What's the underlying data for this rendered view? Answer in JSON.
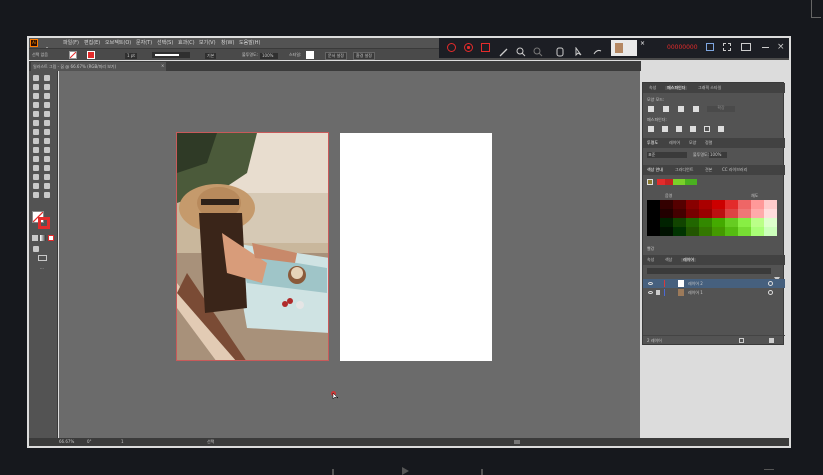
{
  "app": {
    "logo": "Ai",
    "menu": [
      "파일(F)",
      "편집(E)",
      "오브젝트(O)",
      "문자(T)",
      "선택(S)",
      "효과(C)",
      "보기(V)",
      "창(W)",
      "도움말(H)"
    ]
  },
  "recorder": {
    "stop_label": "00000000",
    "icons": [
      "record-icon",
      "record-icon",
      "screenshot-icon",
      "pen-icon",
      "zoom-in-icon",
      "zoom-out-icon",
      "eraser-icon",
      "pointer-icon",
      "hand-icon"
    ]
  },
  "control_bar": {
    "selection_label": "선택 없음",
    "stroke_label": "1 pt",
    "brush_label": "기본",
    "opacity_label": "불투명도:",
    "opacity_value": "100%",
    "style_label": "스타일:",
    "doc_setup_label": "문서 설정",
    "prefs_label": "환경 설정"
  },
  "doc_tab": {
    "title": "일러스트 그림 - 꿈 @ 66.67% (RGB/미리 보기)",
    "close": "×"
  },
  "panels": {
    "top_tabs": [
      "속성",
      "패스파인더",
      "그래픽 스타일"
    ],
    "shape_mode_label": "모양 모드:",
    "pathfinder_label": "패스파인더:",
    "expand_label": "확장",
    "transparency_tabs": [
      "투명도",
      "레이어",
      "모양",
      "정렬"
    ],
    "blend_mode": "표준",
    "transparency_opacity_label": "불투명도:",
    "transparency_opacity": "100%",
    "color_tabs": [
      "색상 안내",
      "그라디언트",
      "견본",
      "CC 라이브러리"
    ],
    "color_row_labels": [
      "음영",
      "채도"
    ],
    "color_footer": "빨강",
    "layers_tabs": [
      "속성",
      "색상",
      "레이어"
    ],
    "layers": [
      {
        "name": "레이어 2",
        "color": "#d93a3a",
        "selected": true
      },
      {
        "name": "레이어 1",
        "color": "#4b6ad6",
        "selected": false
      }
    ],
    "layers_count": "2 레이어"
  },
  "status_bar": {
    "zoom": "66.67%",
    "angle": "0°",
    "artboard": "1",
    "mode": "선택"
  },
  "colors": {
    "accent": "#e32b2b",
    "panel": "#535353",
    "canvas": "#6b6b6b",
    "frame": "#dcdcdc"
  }
}
